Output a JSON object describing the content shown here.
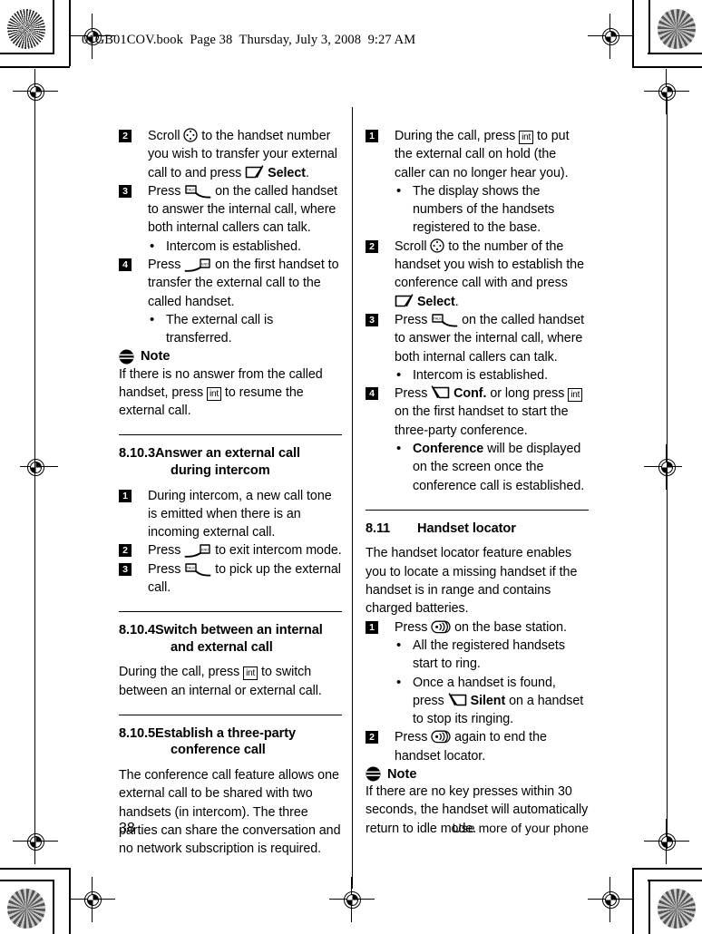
{
  "header": {
    "print_header": "01GB01COV.book  Page 38  Thursday, July 3, 2008  9:27 AM"
  },
  "footer": {
    "page_number": "38",
    "running_head": "Use more of your phone"
  },
  "icons": {
    "scroll": "scroll-navigation-key-icon",
    "talk": "talk-key-icon",
    "end": "end-key-icon",
    "softkey_left": "left-softkey-icon",
    "softkey_right": "right-softkey-icon",
    "int": "int",
    "paging": "paging-key-icon",
    "note": "note-icon"
  },
  "left_column": {
    "continued_steps": [
      {
        "num": "2",
        "parts": [
          {
            "t": "text",
            "v": "Scroll "
          },
          {
            "t": "icon",
            "v": "scroll"
          },
          {
            "t": "text",
            "v": " to the handset number you wish to transfer your external call to and press "
          },
          {
            "t": "icon",
            "v": "softkey_left"
          },
          {
            "t": "text",
            "v": " "
          },
          {
            "t": "bold",
            "v": "Select"
          },
          {
            "t": "text",
            "v": "."
          }
        ],
        "bullets": []
      },
      {
        "num": "3",
        "parts": [
          {
            "t": "text",
            "v": "Press "
          },
          {
            "t": "icon",
            "v": "talk"
          },
          {
            "t": "text",
            "v": " on the called handset to answer the internal call, where both internal callers can talk."
          }
        ],
        "bullets": [
          "Intercom is established."
        ]
      },
      {
        "num": "4",
        "parts": [
          {
            "t": "text",
            "v": "Press "
          },
          {
            "t": "icon",
            "v": "end"
          },
          {
            "t": "text",
            "v": " on the first handset to transfer the external call to the called handset."
          }
        ],
        "bullets": [
          "The external call is transferred."
        ]
      }
    ],
    "note": {
      "label": "Note",
      "parts": [
        {
          "t": "text",
          "v": "If there is no answer from the called handset, press "
        },
        {
          "t": "icon",
          "v": "int"
        },
        {
          "t": "text",
          "v": " to resume the external call."
        }
      ]
    },
    "sections": [
      {
        "number": "8.10.3",
        "title_line1": "Answer an external call",
        "title_line2": "during intercom",
        "steps": [
          {
            "num": "1",
            "parts": [
              {
                "t": "text",
                "v": "During intercom, a new call tone is emitted when there is an incoming external call."
              }
            ],
            "bullets": []
          },
          {
            "num": "2",
            "parts": [
              {
                "t": "text",
                "v": "Press "
              },
              {
                "t": "icon",
                "v": "end"
              },
              {
                "t": "text",
                "v": " to exit intercom mode."
              }
            ],
            "bullets": []
          },
          {
            "num": "3",
            "parts": [
              {
                "t": "text",
                "v": "Press "
              },
              {
                "t": "icon",
                "v": "talk"
              },
              {
                "t": "text",
                "v": " to pick up the external call."
              }
            ],
            "bullets": []
          }
        ]
      },
      {
        "number": "8.10.4",
        "title_line1": "Switch between an internal",
        "title_line2": "and external call",
        "body_parts": [
          {
            "t": "text",
            "v": "During the call, press "
          },
          {
            "t": "icon",
            "v": "int"
          },
          {
            "t": "text",
            "v": " to switch between an internal or external call."
          }
        ]
      },
      {
        "number": "8.10.5",
        "title_line1": "Establish a three-party",
        "title_line2": "conference call",
        "body_parts": [
          {
            "t": "text",
            "v": "The conference call feature allows one external call to be shared with two handsets (in intercom). The three parties can share the conversation and no network subscription is required."
          }
        ]
      }
    ]
  },
  "right_column": {
    "steps": [
      {
        "num": "1",
        "parts": [
          {
            "t": "text",
            "v": "During the call, press "
          },
          {
            "t": "icon",
            "v": "int"
          },
          {
            "t": "text",
            "v": " to put the external call on hold (the caller can no longer hear you)."
          }
        ],
        "bullets": [
          "The display shows the numbers of the handsets registered to the base."
        ]
      },
      {
        "num": "2",
        "parts": [
          {
            "t": "text",
            "v": "Scroll "
          },
          {
            "t": "icon",
            "v": "scroll"
          },
          {
            "t": "text",
            "v": " to the number of the handset you wish to establish the conference call with and press "
          },
          {
            "t": "icon",
            "v": "softkey_left"
          },
          {
            "t": "text",
            "v": " "
          },
          {
            "t": "bold",
            "v": "Select"
          },
          {
            "t": "text",
            "v": "."
          }
        ],
        "bullets": []
      },
      {
        "num": "3",
        "parts": [
          {
            "t": "text",
            "v": "Press "
          },
          {
            "t": "icon",
            "v": "talk"
          },
          {
            "t": "text",
            "v": " on the called handset to answer the internal call, where both internal callers can talk."
          }
        ],
        "bullets": [
          "Intercom is established."
        ]
      },
      {
        "num": "4",
        "parts": [
          {
            "t": "text",
            "v": "Press "
          },
          {
            "t": "icon",
            "v": "softkey_right"
          },
          {
            "t": "text",
            "v": " "
          },
          {
            "t": "bold",
            "v": "Conf."
          },
          {
            "t": "text",
            "v": " or long press "
          },
          {
            "t": "icon",
            "v": "int"
          },
          {
            "t": "text",
            "v": " on the first handset to start the three-party conference."
          }
        ],
        "bullets_rich": [
          [
            {
              "t": "bold",
              "v": "Conference"
            },
            {
              "t": "text",
              "v": " will be displayed on the screen once the conference call is established."
            }
          ]
        ]
      }
    ],
    "section": {
      "number": "8.11",
      "title": "Handset locator",
      "intro": "The handset locator feature enables you to locate a missing handset if the handset is in range and contains charged batteries.",
      "steps": [
        {
          "num": "1",
          "parts": [
            {
              "t": "text",
              "v": "Press "
            },
            {
              "t": "icon",
              "v": "paging"
            },
            {
              "t": "text",
              "v": " on the base station."
            }
          ],
          "bullets_rich": [
            [
              {
                "t": "text",
                "v": "All the registered handsets start to ring."
              }
            ],
            [
              {
                "t": "text",
                "v": "Once a handset is found, press "
              },
              {
                "t": "icon",
                "v": "softkey_right"
              },
              {
                "t": "text",
                "v": " "
              },
              {
                "t": "bold",
                "v": "Silent"
              },
              {
                "t": "text",
                "v": " on a handset to stop its ringing."
              }
            ]
          ]
        },
        {
          "num": "2",
          "parts": [
            {
              "t": "text",
              "v": "Press "
            },
            {
              "t": "icon",
              "v": "paging"
            },
            {
              "t": "text",
              "v": " again to end the handset locator."
            }
          ],
          "bullets": []
        }
      ]
    },
    "note": {
      "label": "Note",
      "parts": [
        {
          "t": "text",
          "v": "If there are no key presses within 30 seconds, the handset will automatically return to idle mode."
        }
      ]
    }
  }
}
